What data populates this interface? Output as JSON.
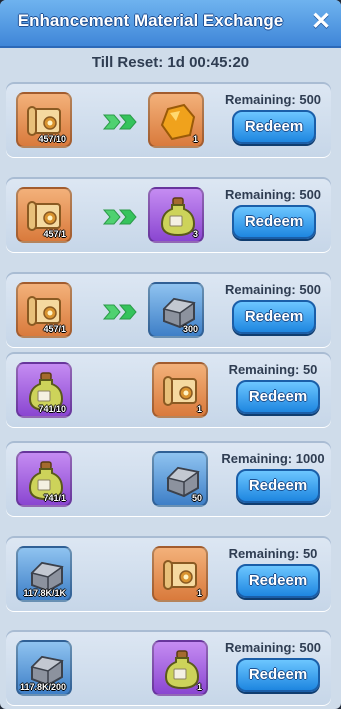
{
  "dialog": {
    "title": "Enhancement Material Exchange",
    "close_icon": "close-icon",
    "reset_label": "Till Reset: 1d 00:45:20"
  },
  "rows": [
    {
      "from_icon": "scroll-icon",
      "from_color": "orange",
      "from_qty": "457/10",
      "to_icon": "amber-ore-icon",
      "to_color": "orange",
      "to_qty": "1",
      "arrows": true,
      "remaining": "Remaining: 500",
      "button": "Redeem"
    },
    {
      "from_icon": "scroll-icon",
      "from_color": "orange",
      "from_qty": "457/1",
      "to_icon": "potion-bottle-icon",
      "to_color": "purple",
      "to_qty": "3",
      "arrows": true,
      "remaining": "Remaining: 500",
      "button": "Redeem"
    },
    {
      "from_icon": "scroll-icon",
      "from_color": "orange",
      "from_qty": "457/1",
      "to_icon": "silver-ingot-icon",
      "to_color": "blue",
      "to_qty": "300",
      "arrows": true,
      "remaining": "Remaining: 500",
      "button": "Redeem"
    },
    {
      "from_icon": "potion-bottle-icon",
      "from_color": "purple",
      "from_qty": "741/10",
      "to_icon": "scroll-icon",
      "to_color": "orange",
      "to_qty": "1",
      "arrows": false,
      "remaining": "Remaining: 50",
      "button": "Redeem"
    },
    {
      "from_icon": "potion-bottle-icon",
      "from_color": "purple",
      "from_qty": "741/1",
      "to_icon": "silver-ingot-icon",
      "to_color": "blue",
      "to_qty": "50",
      "arrows": false,
      "remaining": "Remaining: 1000",
      "button": "Redeem"
    },
    {
      "from_icon": "silver-ingot-icon",
      "from_color": "blue",
      "from_qty": "117.8K/1K",
      "to_icon": "scroll-icon",
      "to_color": "orange",
      "to_qty": "1",
      "arrows": false,
      "remaining": "Remaining: 50",
      "button": "Redeem"
    },
    {
      "from_icon": "silver-ingot-icon",
      "from_color": "blue",
      "from_qty": "117.8K/200",
      "to_icon": "potion-bottle-icon",
      "to_color": "purple",
      "to_qty": "1",
      "arrows": false,
      "remaining": "Remaining: 500",
      "button": "Redeem"
    }
  ]
}
